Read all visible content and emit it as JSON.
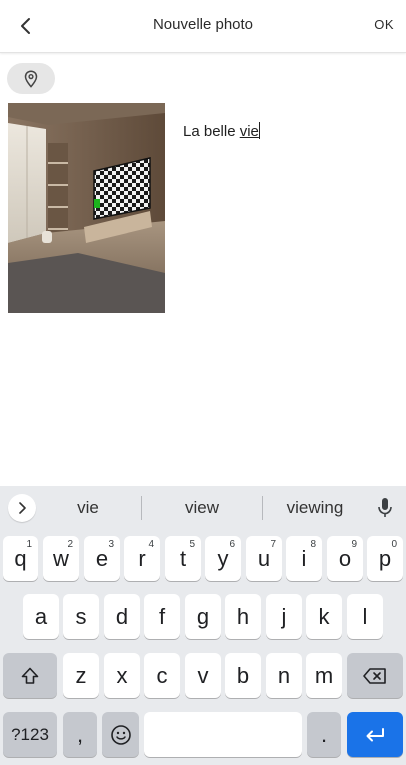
{
  "header": {
    "back_icon": "chevron-left-icon",
    "title": "Nouvelle photo",
    "ok_label": "OK"
  },
  "location_chip": {
    "icon": "map-pin-icon"
  },
  "photo": {
    "subject": "room-with-tv"
  },
  "caption": {
    "prefix": "La belle ",
    "composing": "vie"
  },
  "keyboard": {
    "suggestions": [
      "vie",
      "view",
      "viewing"
    ],
    "row1": [
      {
        "key": "q",
        "hint": "1"
      },
      {
        "key": "w",
        "hint": "2"
      },
      {
        "key": "e",
        "hint": "3"
      },
      {
        "key": "r",
        "hint": "4"
      },
      {
        "key": "t",
        "hint": "5"
      },
      {
        "key": "y",
        "hint": "6"
      },
      {
        "key": "u",
        "hint": "7"
      },
      {
        "key": "i",
        "hint": "8"
      },
      {
        "key": "o",
        "hint": "9"
      },
      {
        "key": "p",
        "hint": "0"
      }
    ],
    "row2": [
      "a",
      "s",
      "d",
      "f",
      "g",
      "h",
      "j",
      "k",
      "l"
    ],
    "row3": [
      "z",
      "x",
      "c",
      "v",
      "b",
      "n",
      "m"
    ],
    "symbols_label": "?123",
    "comma": ",",
    "period": ".",
    "colors": {
      "background": "#e8eaed",
      "function_key": "#c5c8ce",
      "enter": "#1a73e8"
    }
  }
}
